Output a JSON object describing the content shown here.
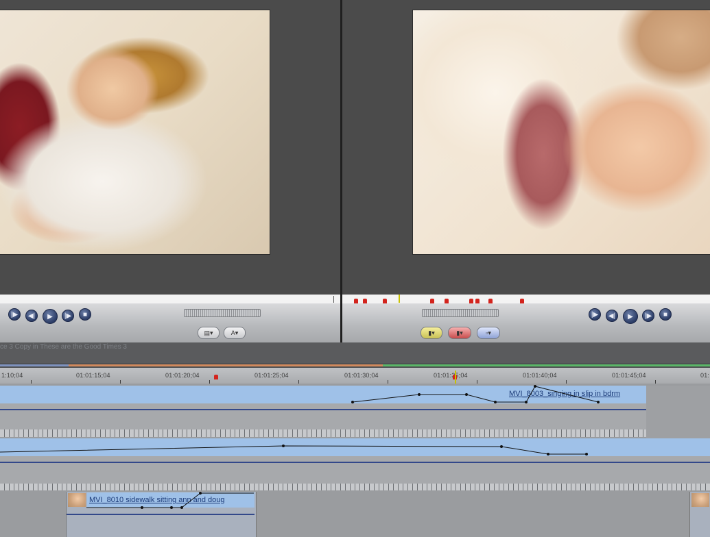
{
  "viewer": {
    "timecodes": [
      "1:10;04",
      "01:01:15;04",
      "01:01:20;04",
      "01:01:25;04",
      "01:01:30;04",
      "01:01:35;04",
      "01:01:40;04",
      "01:01:45;04",
      "01:"
    ]
  },
  "sequence_tab": {
    "title": "ce 3 Copy in These are the Good Times 3"
  },
  "tracks": {
    "clip_top_label": "MVI_8003_singing in slip in bdrm",
    "clip_bottom_label": "MVI_8010 sidewalk sitting ann and doug"
  },
  "colors": {
    "accent_blue": "#9fc1e8",
    "marker_red": "#d3241d",
    "panel_gray": "#4b4b4b"
  }
}
